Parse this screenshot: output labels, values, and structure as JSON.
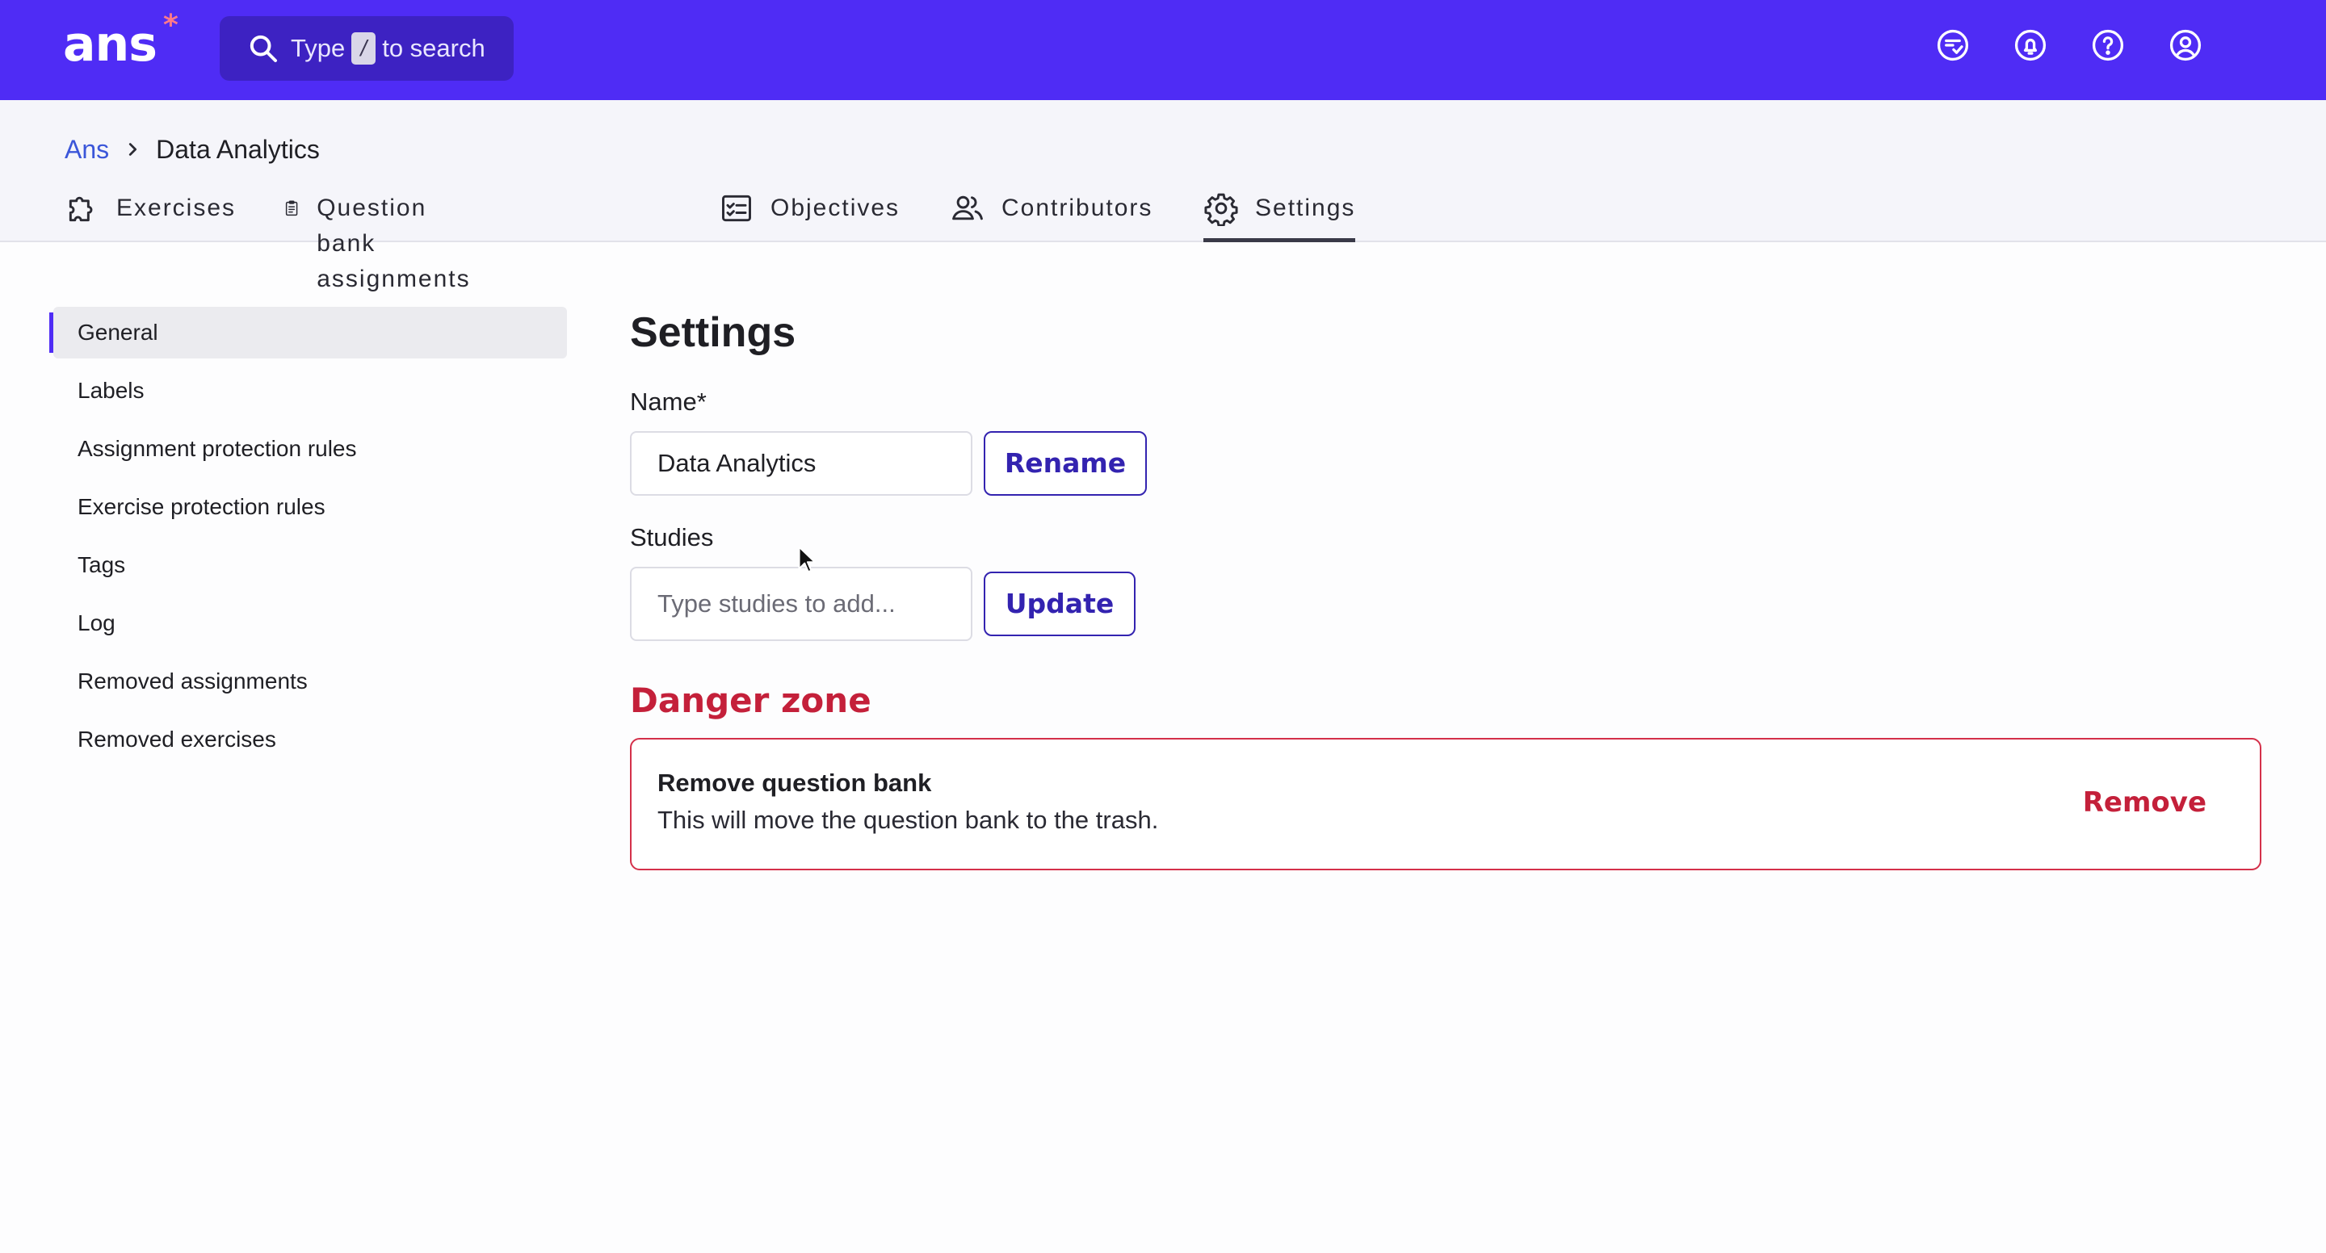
{
  "topbar": {
    "logo_text": "ans",
    "logo_star": "*",
    "search": {
      "prefix": "Type",
      "key": "/",
      "suffix": "to search"
    },
    "icons": [
      "chat-check-icon",
      "bell-icon",
      "help-icon",
      "account-icon"
    ],
    "colors": {
      "background": "#4f2cf5",
      "search_bg": "#3d22c2",
      "star": "#ff7a8a"
    }
  },
  "breadcrumb": {
    "root": "Ans",
    "current": "Data Analytics"
  },
  "tabs": [
    {
      "label": "Exercises",
      "icon": "puzzle-icon"
    },
    {
      "label": "Question bank assignments",
      "icon": "clipboard-icon"
    },
    {
      "label": "Objectives",
      "icon": "checklist-icon"
    },
    {
      "label": "Contributors",
      "icon": "users-icon"
    },
    {
      "label": "Settings",
      "icon": "gear-icon",
      "active": true
    }
  ],
  "sidebar": {
    "items": [
      {
        "label": "General",
        "active": true
      },
      {
        "label": "Labels"
      },
      {
        "label": "Assignment protection rules"
      },
      {
        "label": "Exercise protection rules"
      },
      {
        "label": "Tags"
      },
      {
        "label": "Log"
      },
      {
        "label": "Removed assignments"
      },
      {
        "label": "Removed exercises"
      }
    ]
  },
  "main": {
    "title": "Settings",
    "name": {
      "label": "Name*",
      "value": "Data Analytics",
      "button": "Rename"
    },
    "studies": {
      "label": "Studies",
      "placeholder": "Type studies to add...",
      "button": "Update"
    },
    "danger_zone": {
      "title": "Danger zone",
      "heading": "Remove question bank",
      "description": "This will move the question bank to the trash.",
      "button": "Remove",
      "color": "#c4203a"
    }
  }
}
